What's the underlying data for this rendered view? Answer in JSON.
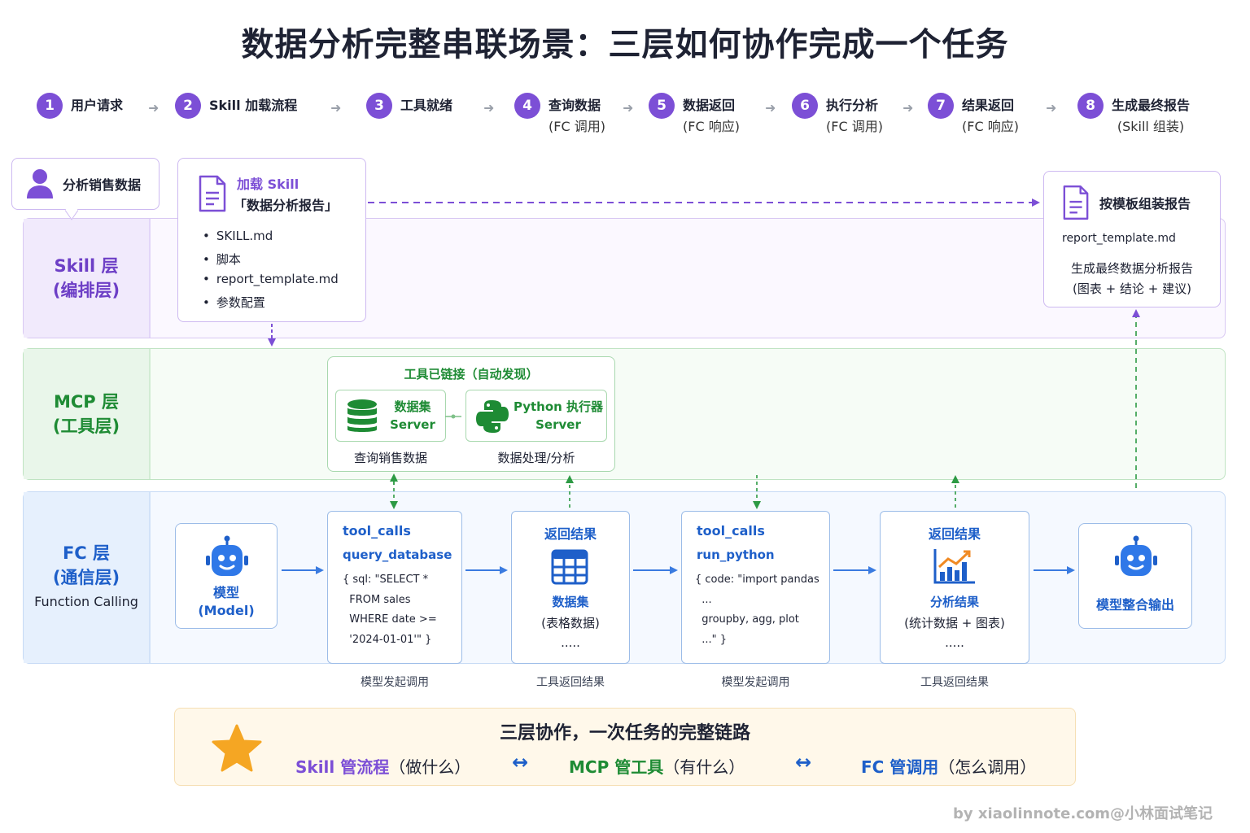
{
  "title": "数据分析完整串联场景：三层如何协作完成一个任务",
  "steps": [
    {
      "num": "1",
      "line1": "用户请求",
      "line2": ""
    },
    {
      "num": "2",
      "line1": "Skill 加载流程",
      "line2": ""
    },
    {
      "num": "3",
      "line1": "工具就绪",
      "line2": ""
    },
    {
      "num": "4",
      "line1": "查询数据",
      "line2": "(FC 调用)"
    },
    {
      "num": "5",
      "line1": "数据返回",
      "line2": "(FC 响应)"
    },
    {
      "num": "6",
      "line1": "执行分析",
      "line2": "(FC 调用)"
    },
    {
      "num": "7",
      "line1": "结果返回",
      "line2": "(FC 响应)"
    },
    {
      "num": "8",
      "line1": "生成最终报告",
      "line2": "(Skill 组装)"
    }
  ],
  "layers": {
    "skill": {
      "line1": "Skill 层",
      "line2": "(编排层)"
    },
    "mcp": {
      "line1": "MCP 层",
      "line2": "(工具层)"
    },
    "fc": {
      "line1": "FC 层",
      "line2": "(通信层)",
      "line3": "Function Calling"
    }
  },
  "user_request": {
    "label": "分析销售数据"
  },
  "skill_card": {
    "heading": "加载 Skill",
    "name": "「数据分析报告」",
    "items": [
      "SKILL.md",
      "脚本",
      "report_template.md",
      "参数配置"
    ]
  },
  "report_card": {
    "heading": "按模板组装报告",
    "file": "report_template.md",
    "line1": "生成最终数据分析报告",
    "line2": "(图表 + 结论 + 建议)"
  },
  "mcp": {
    "title": "工具已链接（自动发现）",
    "servers": [
      {
        "line1": "数据集",
        "line2": "Server",
        "caption": "查询销售数据"
      },
      {
        "line1": "Python 执行器",
        "line2": "Server",
        "caption": "数据处理/分析"
      }
    ]
  },
  "fc": {
    "model": {
      "line1": "模型",
      "line2": "(Model)"
    },
    "call1": {
      "title": "tool_calls",
      "func": "query_database",
      "code": [
        "{ sql: \"SELECT *",
        "  FROM sales",
        "  WHERE date >=",
        "  '2024-01-01'\" }"
      ],
      "caption": "模型发起调用"
    },
    "result1": {
      "title": "返回结果",
      "line1": "数据集",
      "line2": "(表格数据)",
      "more": ".....",
      "caption": "工具返回结果"
    },
    "call2": {
      "title": "tool_calls",
      "func": "run_python",
      "code": [
        "{ code: \"import pandas",
        "  ...",
        "  groupby, agg, plot",
        "  ...\" }"
      ],
      "caption": "模型发起调用"
    },
    "result2": {
      "title": "返回结果",
      "line1": "分析结果",
      "line2": "(统计数据 + 图表)",
      "more": ".....",
      "caption": "工具返回结果"
    },
    "output": {
      "label": "模型整合输出"
    }
  },
  "summary": {
    "title": "三层协作，一次任务的完整链路",
    "skill_kw": "Skill 管流程",
    "skill_desc": "（做什么）",
    "mcp_kw": "MCP 管工具",
    "mcp_desc": "（有什么）",
    "fc_kw": "FC 管调用",
    "fc_desc": "（怎么调用）",
    "swap_symbol": "↔"
  },
  "credit": "by xiaolinnote.com@小林面试笔记",
  "colors": {
    "purple": "#7c4fd6",
    "green": "#1e8b34",
    "blue": "#1e5fc9",
    "star": "#f5a623"
  }
}
